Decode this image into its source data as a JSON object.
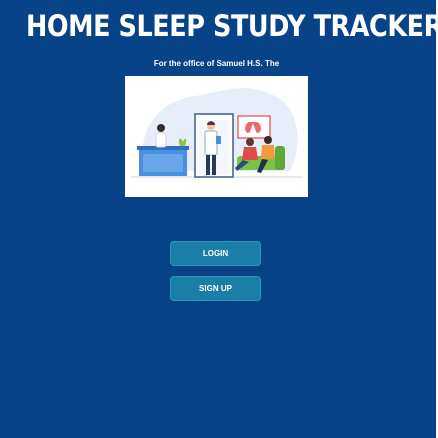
{
  "header": {
    "title": "HOME SLEEP STUDY TRACKER",
    "subtitle": "For the office of Samuel H.S. The"
  },
  "hero": {
    "image_name": "clinic-waiting-room-illustration"
  },
  "auth": {
    "login_label": "LOGIN",
    "signup_label": "SIGN UP"
  },
  "colors": {
    "background": "#084388",
    "button": "#1a7fa6",
    "text": "#ffffff"
  }
}
